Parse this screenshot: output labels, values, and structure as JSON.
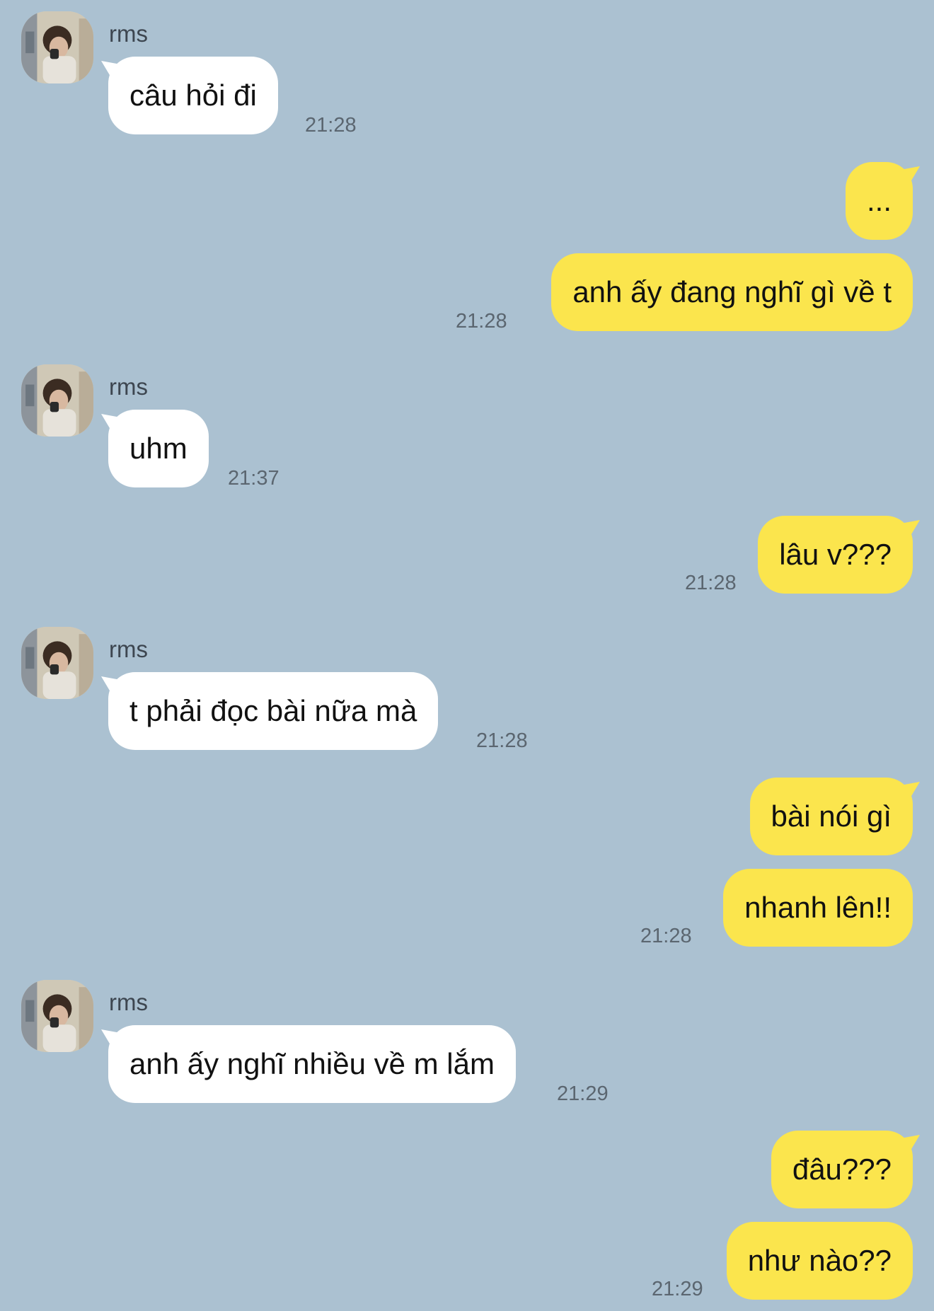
{
  "contact": {
    "name": "rms"
  },
  "messages": [
    {
      "id": 1,
      "side": "in",
      "sender": "rms",
      "text": "câu hỏi đi",
      "time": "21:28"
    },
    {
      "id": 2,
      "side": "out",
      "text": "...",
      "time": ""
    },
    {
      "id": 3,
      "side": "out",
      "text": "anh ấy đang nghĩ gì về t",
      "time": "21:28"
    },
    {
      "id": 4,
      "side": "in",
      "sender": "rms",
      "text": "uhm",
      "time": "21:37"
    },
    {
      "id": 5,
      "side": "out",
      "text": "lâu v???",
      "time": "21:28"
    },
    {
      "id": 6,
      "side": "in",
      "sender": "rms",
      "text": "t phải đọc bài nữa mà",
      "time": "21:28"
    },
    {
      "id": 7,
      "side": "out",
      "text": "bài nói gì",
      "time": ""
    },
    {
      "id": 8,
      "side": "out",
      "text": "nhanh lên!!",
      "time": "21:28"
    },
    {
      "id": 9,
      "side": "in",
      "sender": "rms",
      "text": "anh ấy nghĩ nhiều về m lắm",
      "time": "21:29"
    },
    {
      "id": 10,
      "side": "out",
      "text": "đâu???",
      "time": ""
    },
    {
      "id": 11,
      "side": "out",
      "text": "như nào??",
      "time": "21:29"
    }
  ],
  "colors": {
    "background": "#abc1d1",
    "incoming_bubble": "#ffffff",
    "outgoing_bubble": "#fbe54d"
  },
  "icons": {
    "avatar": "profile-photo"
  }
}
